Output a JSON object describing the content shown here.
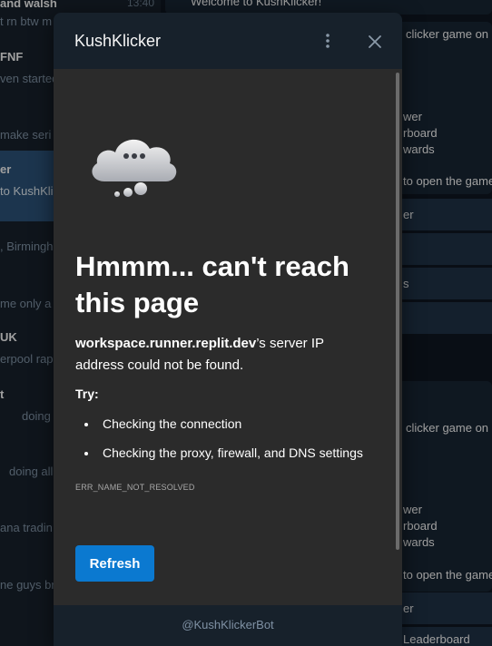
{
  "background": {
    "chats": [
      {
        "name": "and walsh",
        "preview": "t rn btw m",
        "time": "13:40",
        "active": false
      },
      {
        "name": "FNF",
        "preview": "ven started",
        "active": false
      },
      {
        "name": "",
        "preview": "make seri",
        "active": false
      },
      {
        "name": "er",
        "preview": "to KushKlick",
        "active": true
      },
      {
        "name": "",
        "preview": ", Birmingh",
        "active": false
      },
      {
        "name": "",
        "preview": "me only a r",
        "active": false
      },
      {
        "name": "UK",
        "preview": "erpool rap",
        "active": false
      },
      {
        "name": "t",
        "preview": "doing",
        "active": false
      },
      {
        "name": "",
        "preview": "doing all",
        "active": false
      },
      {
        "name": "",
        "preview": "ana tradin",
        "active": false
      },
      {
        "name": "",
        "preview": "ne guys bro",
        "active": false
      }
    ],
    "welcome_text": "Welcome to KushKlicker!",
    "messages": [
      {
        "line1": "clicker game on",
        "line2": "wer",
        "line3": "rboard",
        "line4": "wards",
        "line5": "to open the game"
      },
      {
        "line1": "clicker game on",
        "line2": "wer",
        "line3": "rboard",
        "line4": "wards",
        "line5": "to open the game"
      }
    ],
    "kb_labels": [
      "er",
      "s",
      "er",
      "Leaderboard"
    ]
  },
  "popup": {
    "title": "KushKlicker",
    "more_icon": "more-vertical-icon",
    "close_icon": "close-icon",
    "footer": "@KushKlickerBot"
  },
  "error_page": {
    "title": "Hmmm... can't reach this page",
    "host": "workspace.runner.replit.dev",
    "message_rest": "’s server IP address could not be found.",
    "try_label": "Try:",
    "tips": [
      "Checking the connection",
      "Checking the proxy, firewall, and DNS settings"
    ],
    "error_code": "ERR_NAME_NOT_RESOLVED",
    "refresh_label": "Refresh",
    "icon": "cloud-error-icon"
  },
  "colors": {
    "accent": "#0b79d0",
    "panel": "#17212b",
    "page_bg": "#2b2b2b",
    "active_chat": "#2b5278"
  }
}
